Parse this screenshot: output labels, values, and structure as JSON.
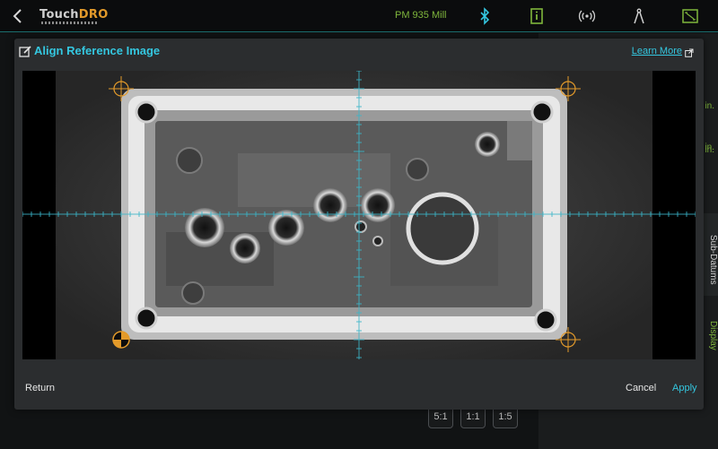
{
  "topbar": {
    "brand_main": "Touch",
    "brand_accent": "DRO",
    "machine": "PM 935 Mill",
    "icons": [
      "back-icon",
      "bluetooth-icon",
      "info-icon",
      "wireless-icon",
      "compass-icon",
      "fit-screen-icon"
    ]
  },
  "side_panel": {
    "units": [
      "in.",
      "in.",
      "in."
    ],
    "tab_subdatums": "Sub-Datums",
    "tab_display": "Display"
  },
  "zoom": [
    "5:1",
    "1:1",
    "1:5"
  ],
  "dialog": {
    "title": "Align Reference Image",
    "learn_more": "Learn More",
    "return_label": "Return",
    "cancel_label": "Cancel",
    "apply_label": "Apply"
  },
  "colors": {
    "accent": "#34c7e0",
    "green": "#7fb63c",
    "crosshair": "#3bb6c9",
    "target": "#e39a2a"
  }
}
